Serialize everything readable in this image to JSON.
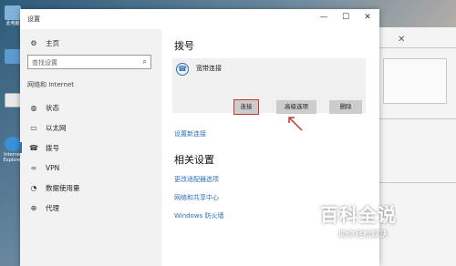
{
  "desktop": {
    "icons": [
      {
        "caption": "此电脑"
      },
      {
        "caption": ""
      },
      {
        "caption": ""
      },
      {
        "caption": "Internet Explorer"
      }
    ]
  },
  "window": {
    "title": "设置",
    "minimize": "—",
    "maximize": "☐",
    "close": "✕"
  },
  "sidebar": {
    "home": "主页",
    "search_placeholder": "查找设置",
    "section": "网络和 Internet",
    "items": [
      {
        "icon": "status",
        "label": "状态"
      },
      {
        "icon": "ethernet",
        "label": "以太网"
      },
      {
        "icon": "dialup",
        "label": "拨号"
      },
      {
        "icon": "vpn",
        "label": "VPN"
      },
      {
        "icon": "data-usage",
        "label": "数据使用量"
      },
      {
        "icon": "proxy",
        "label": "代理"
      }
    ]
  },
  "main": {
    "title": "拨号",
    "connection": {
      "name": "宽带连接",
      "buttons": {
        "connect": "连接",
        "advanced": "高级选项",
        "delete": "删除"
      }
    },
    "setup_link": "设置新连接",
    "related_title": "相关设置",
    "related_links": [
      "更改适配器选项",
      "网络和共享中心",
      "Windows 防火墙"
    ]
  },
  "watermark": {
    "big": "百科全说",
    "small": "助你轻松解决"
  },
  "colors": {
    "accent": "#2b6fb6",
    "highlight": "#c0392b"
  }
}
